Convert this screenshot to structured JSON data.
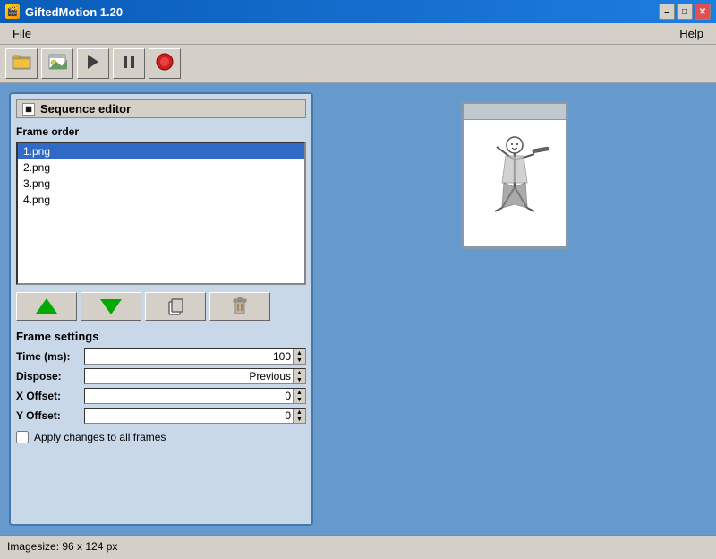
{
  "window": {
    "title": "GiftedMotion 1.20",
    "min_label": "–",
    "max_label": "□",
    "close_label": "✕"
  },
  "menu": {
    "file_label": "File",
    "help_label": "Help"
  },
  "toolbar": {
    "open_icon": "📂",
    "image_icon": "🖼",
    "play_icon": "▶",
    "pause_icon": "⏸",
    "record_icon": "⏺"
  },
  "sequence_editor": {
    "panel_title": "Sequence editor",
    "frame_order_label": "Frame order",
    "frames": [
      "1.png",
      "2.png",
      "3.png",
      "4.png"
    ],
    "selected_frame_index": 0
  },
  "action_buttons": {
    "up_arrow": "▲",
    "down_arrow": "▼",
    "copy_icon": "⧉",
    "delete_icon": "🗑"
  },
  "frame_settings": {
    "section_label": "Frame settings",
    "time_label": "Time (ms):",
    "time_value": "100",
    "dispose_label": "Dispose:",
    "dispose_value": "Previous",
    "x_offset_label": "X Offset:",
    "x_offset_value": "0",
    "y_offset_label": "Y Offset:",
    "y_offset_value": "0",
    "apply_all_label": "Apply changes to all frames"
  },
  "status_bar": {
    "text": "Imagesize: 96 x 124 px"
  }
}
